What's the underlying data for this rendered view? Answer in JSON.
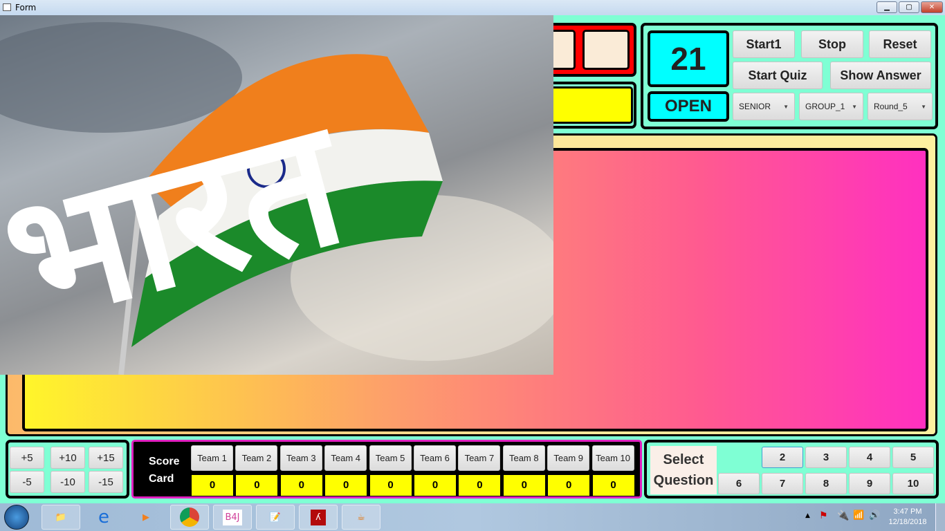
{
  "window": {
    "title": "Form",
    "controls": [
      "minimize",
      "maximize",
      "close"
    ]
  },
  "video": {
    "caption": "भारत"
  },
  "timer": {
    "value": "21",
    "status": "OPEN"
  },
  "controls": {
    "start1": "Start1",
    "stop": "Stop",
    "reset": "Reset",
    "start_quiz": "Start Quiz",
    "show_answer": "Show Answer"
  },
  "dropdowns": {
    "level": "SENIOR",
    "group": "GROUP_1",
    "round": "Round_5"
  },
  "points": {
    "plus": [
      "+5",
      "+10",
      "+15"
    ],
    "minus": [
      "-5",
      "-10",
      "-15"
    ]
  },
  "scorecard": {
    "label_line1": "Score",
    "label_line2": "Card",
    "teams": [
      {
        "name": "Team 1",
        "score": "0"
      },
      {
        "name": "Team 2",
        "score": "0"
      },
      {
        "name": "Team 3",
        "score": "0"
      },
      {
        "name": "Team 4",
        "score": "0"
      },
      {
        "name": "Team 5",
        "score": "0"
      },
      {
        "name": "Team 6",
        "score": "0"
      },
      {
        "name": "Team 7",
        "score": "0"
      },
      {
        "name": "Team 8",
        "score": "0"
      },
      {
        "name": "Team 9",
        "score": "0"
      },
      {
        "name": "Team 10",
        "score": "0"
      }
    ]
  },
  "questions": {
    "label_line1": "Select",
    "label_line2": "Question",
    "row1": [
      "2",
      "3",
      "4",
      "5"
    ],
    "row2": [
      "6",
      "7",
      "8",
      "9",
      "10"
    ]
  },
  "taskbar": {
    "apps": [
      "start",
      "explorer",
      "internet-explorer",
      "media-player",
      "chrome",
      "B4J",
      "notepad",
      "acrobat",
      "java"
    ],
    "b4j_label": "B4J",
    "time": "3:47 PM",
    "date": "12/18/2018"
  }
}
